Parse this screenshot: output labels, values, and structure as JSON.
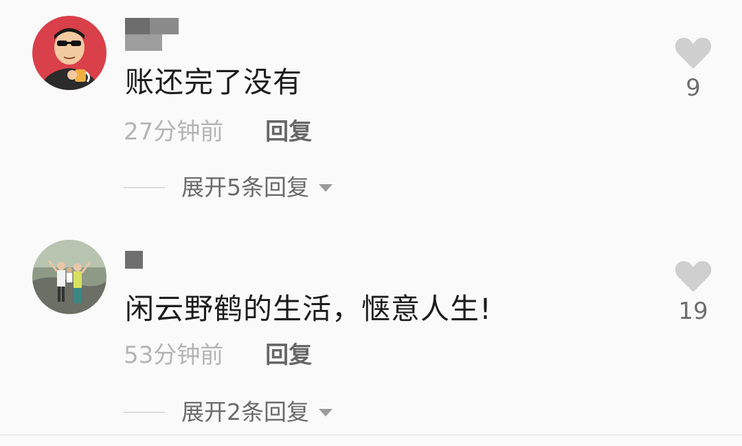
{
  "comments": [
    {
      "text": "账还完了没有",
      "time": "27分钟前",
      "reply_label": "回复",
      "expand_label": "展开5条回复",
      "likes": "9"
    },
    {
      "text": "闲云野鹤的生活，惬意人生!",
      "time": "53分钟前",
      "reply_label": "回复",
      "expand_label": "展开2条回复",
      "likes": "19"
    }
  ],
  "colors": {
    "background": "#fafafa",
    "heart": "#cfcfcf",
    "avatar1_bg": "#d9404a"
  }
}
